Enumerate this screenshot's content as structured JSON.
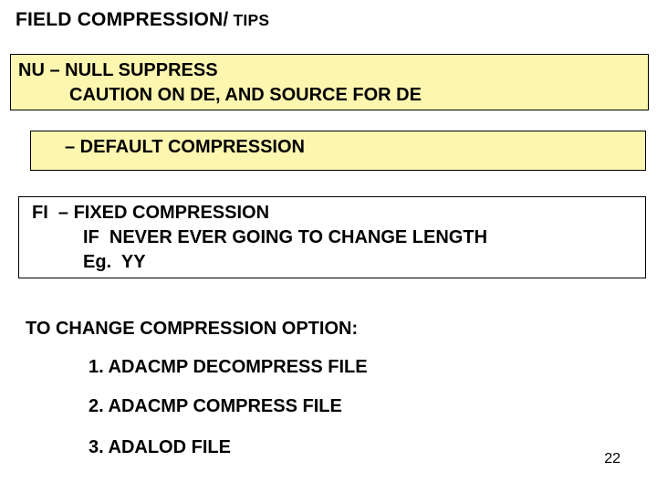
{
  "title": {
    "main": "FIELD COMPRESSION/",
    "small": " TIPS"
  },
  "box1": {
    "line1": "NU – NULL SUPPRESS",
    "line2": "CAUTION ON DE, AND SOURCE FOR DE"
  },
  "box2": {
    "line1": "– DEFAULT COMPRESSION"
  },
  "box3": {
    "line1": "FI  – FIXED COMPRESSION",
    "line2": "IF  NEVER EVER GOING TO CHANGE LENGTH",
    "line3": "Eg.  YY"
  },
  "change": {
    "heading": "TO CHANGE COMPRESSION OPTION:",
    "step1": "1. ADACMP DECOMPRESS FILE",
    "step2": "2. ADACMP COMPRESS FILE",
    "step3": "3. ADALOD FILE"
  },
  "page_number": "22"
}
